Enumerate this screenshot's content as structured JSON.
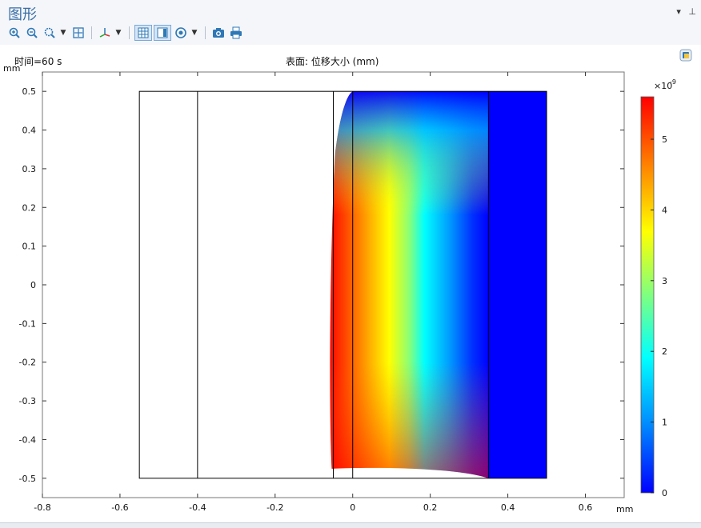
{
  "panel": {
    "title": "图形",
    "controls": {
      "menu_icon": "chevron-down-icon",
      "pin_icon": "pin-icon"
    }
  },
  "toolbar": {
    "buttons": [
      {
        "name": "zoom-in-button",
        "icon": "zoom-in-icon"
      },
      {
        "name": "zoom-out-button",
        "icon": "zoom-out-icon"
      },
      {
        "name": "zoom-box-button",
        "icon": "zoom-box-icon",
        "has_menu": true
      },
      {
        "name": "zoom-extents-button",
        "icon": "zoom-extents-icon"
      },
      {
        "name": "axis-orientation-button",
        "icon": "axis-icon",
        "has_menu": true
      },
      {
        "name": "grid-toggle-button",
        "icon": "grid-icon"
      },
      {
        "name": "legend-toggle-button",
        "icon": "legend-icon"
      },
      {
        "name": "scene-light-button",
        "icon": "light-icon",
        "has_menu": true
      },
      {
        "name": "snapshot-button",
        "icon": "camera-icon"
      },
      {
        "name": "print-button",
        "icon": "print-icon"
      }
    ]
  },
  "plot": {
    "time_label": "时间=60 s",
    "title": "表面: 位移大小 (mm)",
    "side_icon": "plot-settings-icon"
  },
  "chart_data": {
    "type": "heatmap",
    "title": "表面: 位移大小 (mm)",
    "xlabel": "mm",
    "ylabel": "mm",
    "xlim": [
      -0.8,
      0.7
    ],
    "ylim": [
      -0.55,
      0.55
    ],
    "x_ticks": [
      -0.8,
      -0.6,
      -0.4,
      -0.2,
      0,
      0.2,
      0.4,
      0.6
    ],
    "x_tick_labels": [
      "-0.8",
      "-0.6",
      "-0.4",
      "-0.2",
      "0",
      "0.2",
      "0.4",
      "0.6"
    ],
    "y_ticks": [
      0.5,
      0.4,
      0.3,
      0.2,
      0.1,
      0,
      -0.1,
      -0.2,
      -0.3,
      -0.4,
      -0.5
    ],
    "y_tick_labels": [
      "0.5",
      "0.4",
      "0.3",
      "0.2",
      "0.1",
      "0",
      "-0.1",
      "-0.2",
      "-0.3",
      "-0.4",
      "-0.5"
    ],
    "geometry_boundaries": {
      "outer_box": {
        "x": [
          -0.55,
          0.5
        ],
        "y": [
          -0.5,
          0.5
        ]
      },
      "vertical_lines_x": [
        -0.4,
        -0.05,
        0,
        0.35
      ]
    },
    "colorbar": {
      "multiplier": "×10",
      "exponent": "-9",
      "ticks": [
        0,
        1,
        2,
        3,
        4,
        5
      ],
      "tick_labels": [
        "0",
        "1",
        "2",
        "3",
        "4",
        "5"
      ],
      "max": 5.6,
      "colormap": [
        "#0000ff",
        "#00b4ff",
        "#00ffff",
        "#7fff7f",
        "#ffff00",
        "#ff8000",
        "#ff0000"
      ]
    }
  }
}
